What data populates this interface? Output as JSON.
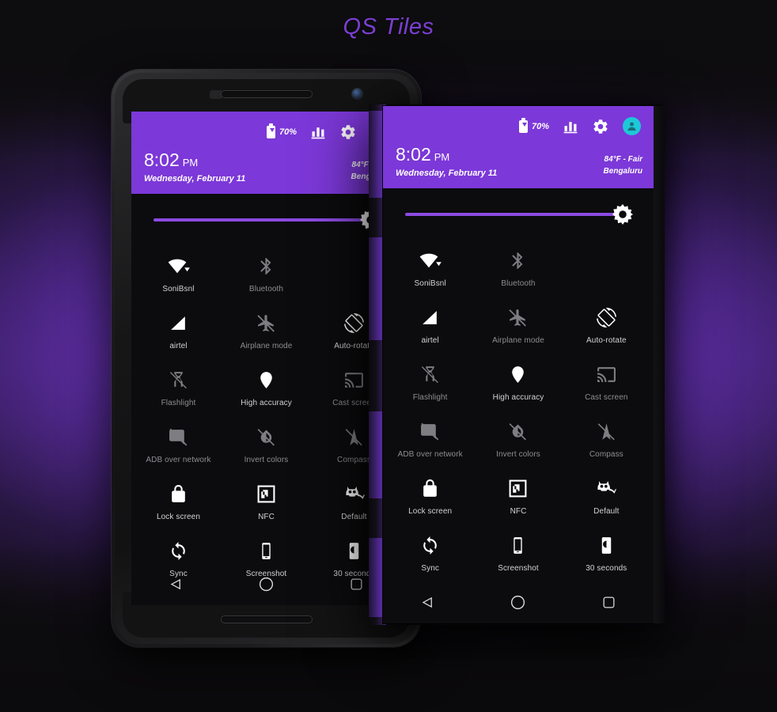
{
  "page": {
    "title": "QS Tiles",
    "accent_purple": "#7c38d8",
    "title_color": "#7b3fd4",
    "panel_bg": "#0c0b0d"
  },
  "status_bar": {
    "battery_percent": "70%",
    "battery_icon": "battery-charging-icon",
    "signal_icon": "signal-bars-icon",
    "settings_icon": "gear-icon",
    "avatar_icon": "user-avatar-icon",
    "avatar_color": "#1ec8d8"
  },
  "header": {
    "time": "8:02",
    "ampm": "PM",
    "date": "Wednesday, February 11",
    "weather": "84°F - Fair",
    "location": "Bengaluru"
  },
  "brightness": {
    "icon": "brightness-sun-icon",
    "value_percent": 100
  },
  "tiles": [
    [
      {
        "label": "SoniBsnl",
        "icon": "wifi-icon",
        "state": "on"
      },
      {
        "label": "Bluetooth",
        "icon": "bluetooth-off-icon",
        "state": "off"
      },
      {
        "label": "",
        "icon": "",
        "state": "empty"
      }
    ],
    [
      {
        "label": "airtel",
        "icon": "cell-signal-icon",
        "state": "on"
      },
      {
        "label": "Airplane mode",
        "icon": "airplane-off-icon",
        "state": "off"
      },
      {
        "label": "Auto-rotate",
        "icon": "auto-rotate-icon",
        "state": "on"
      }
    ],
    [
      {
        "label": "Flashlight",
        "icon": "flashlight-off-icon",
        "state": "off"
      },
      {
        "label": "High accuracy",
        "icon": "location-pin-icon",
        "state": "on"
      },
      {
        "label": "Cast screen",
        "icon": "cast-screen-icon",
        "state": "off"
      }
    ],
    [
      {
        "label": "ADB over network",
        "icon": "adb-network-off-icon",
        "state": "off"
      },
      {
        "label": "Invert colors",
        "icon": "invert-colors-off-icon",
        "state": "off"
      },
      {
        "label": "Compass",
        "icon": "compass-off-icon",
        "state": "off"
      }
    ],
    [
      {
        "label": "Lock screen",
        "icon": "lock-icon",
        "state": "on"
      },
      {
        "label": "NFC",
        "icon": "nfc-icon",
        "state": "on"
      },
      {
        "label": "Default",
        "icon": "cid-mascot-icon",
        "state": "on"
      }
    ],
    [
      {
        "label": "Sync",
        "icon": "sync-icon",
        "state": "on"
      },
      {
        "label": "Screenshot",
        "icon": "screenshot-phone-icon",
        "state": "on"
      },
      {
        "label": "30 seconds",
        "icon": "screen-timeout-icon",
        "state": "on"
      }
    ]
  ],
  "navbar": {
    "back_icon": "nav-back-triangle-icon",
    "home_icon": "nav-home-circle-icon",
    "recents_icon": "nav-recents-square-icon"
  }
}
